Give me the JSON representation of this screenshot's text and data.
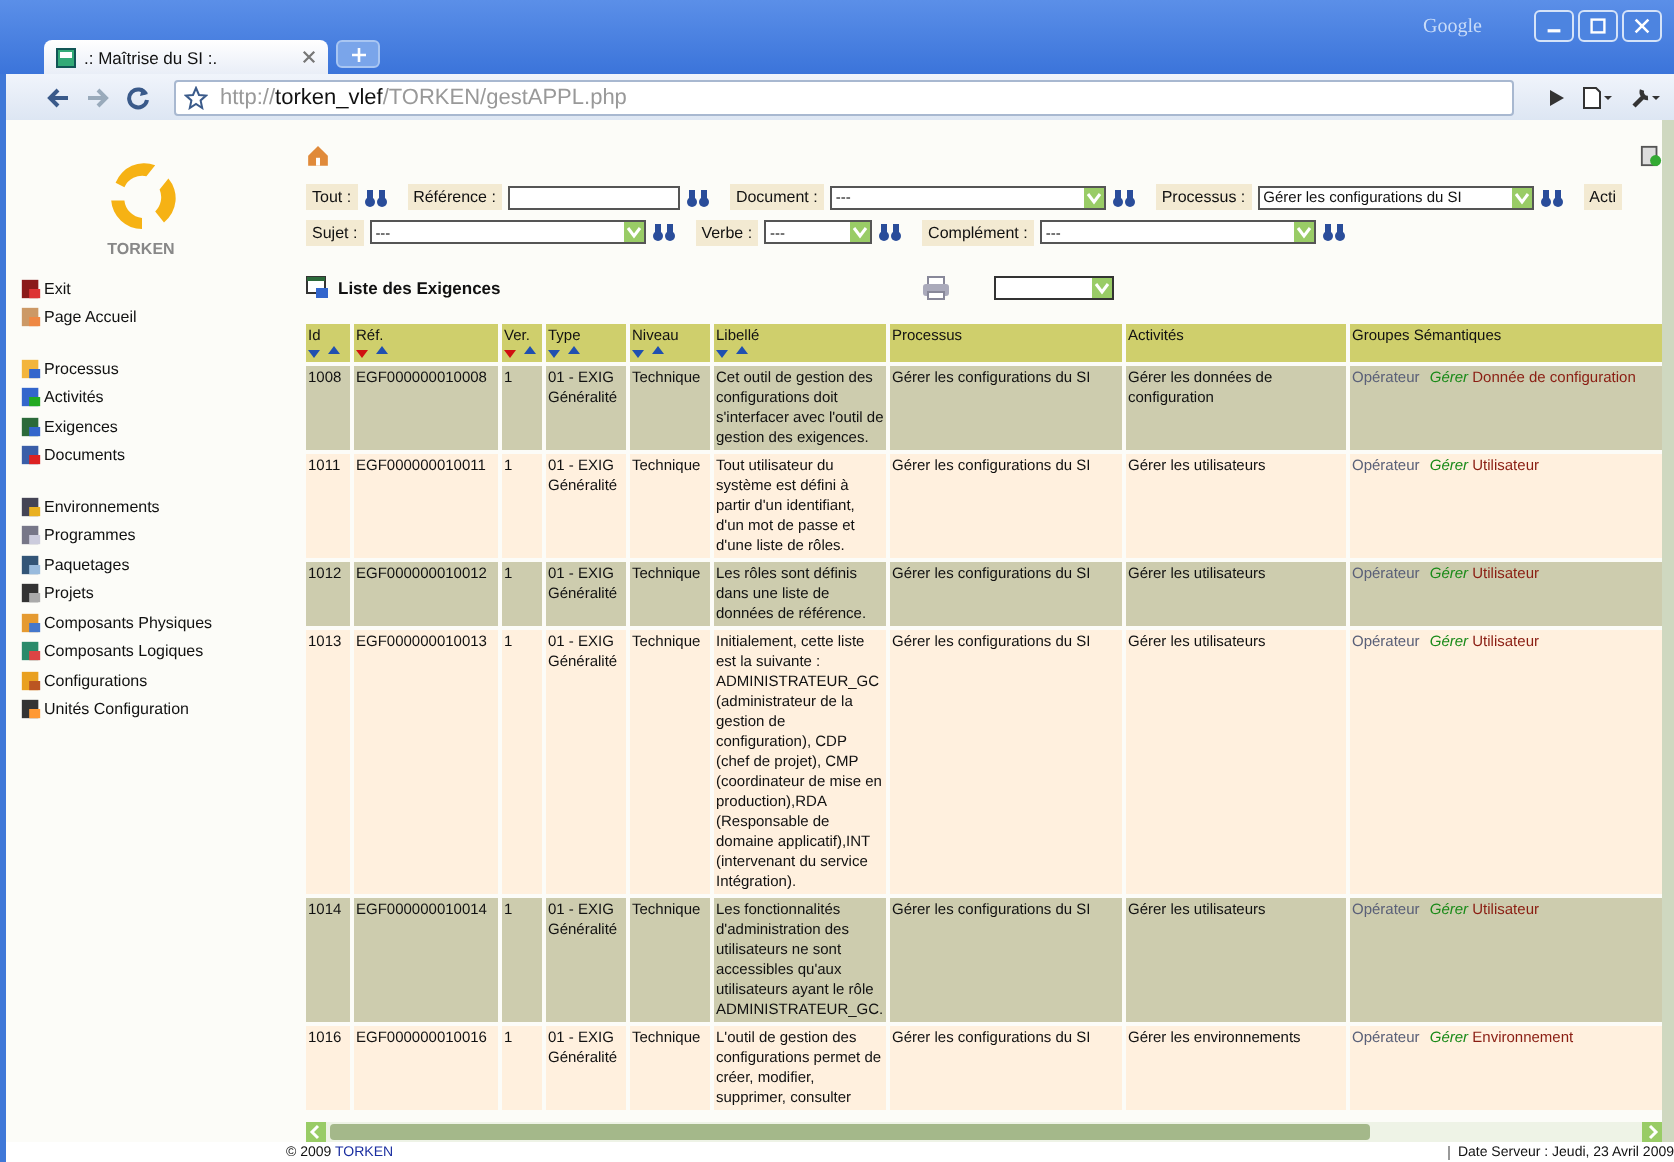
{
  "browser": {
    "tab_title": ".: Maîtrise du SI :.",
    "brand": "Google",
    "url_scheme": "http://",
    "url_host": "torken_vlef",
    "url_path": "/TORKEN/gestAPPL.php"
  },
  "sidebar": {
    "logo_text": "TORKEN",
    "groups": [
      [
        {
          "label": "Exit"
        },
        {
          "label": "Page Accueil"
        }
      ],
      [
        {
          "label": "Processus"
        },
        {
          "label": "Activités"
        },
        {
          "label": "Exigences"
        },
        {
          "label": "Documents"
        }
      ],
      [
        {
          "label": "Environnements"
        },
        {
          "label": "Programmes"
        },
        {
          "label": "Paquetages"
        },
        {
          "label": "Projets"
        },
        {
          "label": "Composants Physiques"
        },
        {
          "label": "Composants Logiques"
        },
        {
          "label": "Configurations"
        },
        {
          "label": "Unités Configuration"
        }
      ]
    ]
  },
  "filters": [
    [
      {
        "label": "Tout :",
        "kind": "none"
      },
      {
        "label": "Référence :",
        "kind": "text"
      },
      {
        "label": "Document :",
        "kind": "select",
        "value": "---"
      },
      {
        "label": "Processus :",
        "kind": "select",
        "value": "Gérer les configurations du SI"
      },
      {
        "label": "Acti",
        "kind": "cut"
      }
    ],
    [
      {
        "label": "Sujet :",
        "kind": "select",
        "value": "---"
      },
      {
        "label": "Verbe :",
        "kind": "select",
        "value": "---"
      },
      {
        "label": "Complément :",
        "kind": "select",
        "value": "---"
      }
    ]
  ],
  "page": {
    "title": "Liste des Exigences"
  },
  "table": {
    "columns": [
      {
        "label": "Id",
        "sortable": true,
        "sorted": false
      },
      {
        "label": "Réf.",
        "sortable": true,
        "sorted": true
      },
      {
        "label": "Ver.",
        "sortable": true,
        "sorted": true
      },
      {
        "label": "Type",
        "sortable": true,
        "sorted": false
      },
      {
        "label": "Niveau",
        "sortable": true,
        "sorted": false
      },
      {
        "label": "Libellé",
        "sortable": true,
        "sorted": false
      },
      {
        "label": "Processus",
        "sortable": false
      },
      {
        "label": "Activités",
        "sortable": false
      },
      {
        "label": "Groupes Sémantiques",
        "sortable": false
      }
    ],
    "rows": [
      {
        "id": "1008",
        "ref": "EGF000000010008",
        "ver": "1",
        "type": "01 - EXIG Généralité",
        "niveau": "Technique",
        "libelle": "Cet outil de gestion des configurations doit s'interfacer avec l'outil de gestion des exigences.",
        "processus": "Gérer les configurations du SI",
        "activites": "Gérer les données de configuration",
        "subject": "Opérateur",
        "verb": "Gérer",
        "complement": "Donnée de configuration"
      },
      {
        "id": "1011",
        "ref": "EGF000000010011",
        "ver": "1",
        "type": "01 - EXIG Généralité",
        "niveau": "Technique",
        "libelle": "Tout utilisateur du système est défini à partir d'un identifiant, d'un mot de passe et d'une liste de rôles.",
        "processus": "Gérer les configurations du SI",
        "activites": "Gérer les utilisateurs",
        "subject": "Opérateur",
        "verb": "Gérer",
        "complement": "Utilisateur"
      },
      {
        "id": "1012",
        "ref": "EGF000000010012",
        "ver": "1",
        "type": "01 - EXIG Généralité",
        "niveau": "Technique",
        "libelle": "Les rôles sont définis dans une liste de données de référence.",
        "processus": "Gérer les configurations du SI",
        "activites": "Gérer les utilisateurs",
        "subject": "Opérateur",
        "verb": "Gérer",
        "complement": "Utilisateur"
      },
      {
        "id": "1013",
        "ref": "EGF000000010013",
        "ver": "1",
        "type": "01 - EXIG Généralité",
        "niveau": "Technique",
        "libelle": "Initialement, cette liste est la suivante : ADMINISTRATEUR_GC (administrateur de la gestion de configuration), CDP (chef de projet), CMP (coordinateur de mise en production),RDA (Responsable de domaine applicatif),INT (intervenant du service Intégration).",
        "processus": "Gérer les configurations du SI",
        "activites": "Gérer les utilisateurs",
        "subject": "Opérateur",
        "verb": "Gérer",
        "complement": "Utilisateur"
      },
      {
        "id": "1014",
        "ref": "EGF000000010014",
        "ver": "1",
        "type": "01 - EXIG Généralité",
        "niveau": "Technique",
        "libelle": "Les fonctionnalités d'administration des utilisateurs ne sont accessibles qu'aux utilisateurs ayant le rôle ADMINISTRATEUR_GC.",
        "processus": "Gérer les configurations du SI",
        "activites": "Gérer les utilisateurs",
        "subject": "Opérateur",
        "verb": "Gérer",
        "complement": "Utilisateur"
      },
      {
        "id": "1016",
        "ref": "EGF000000010016",
        "ver": "1",
        "type": "01 - EXIG Généralité",
        "niveau": "Technique",
        "libelle": "L'outil de gestion des configurations permet de créer, modifier, supprimer, consulter",
        "processus": "Gérer les configurations du SI",
        "activites": "Gérer les environnements",
        "subject": "Opérateur",
        "verb": "Gérer",
        "complement": "Environnement"
      }
    ]
  },
  "footer": {
    "copyright": "© 2009",
    "link": "TORKEN",
    "server_date": "Date Serveur : Jeudi, 23 Avril 2009"
  }
}
